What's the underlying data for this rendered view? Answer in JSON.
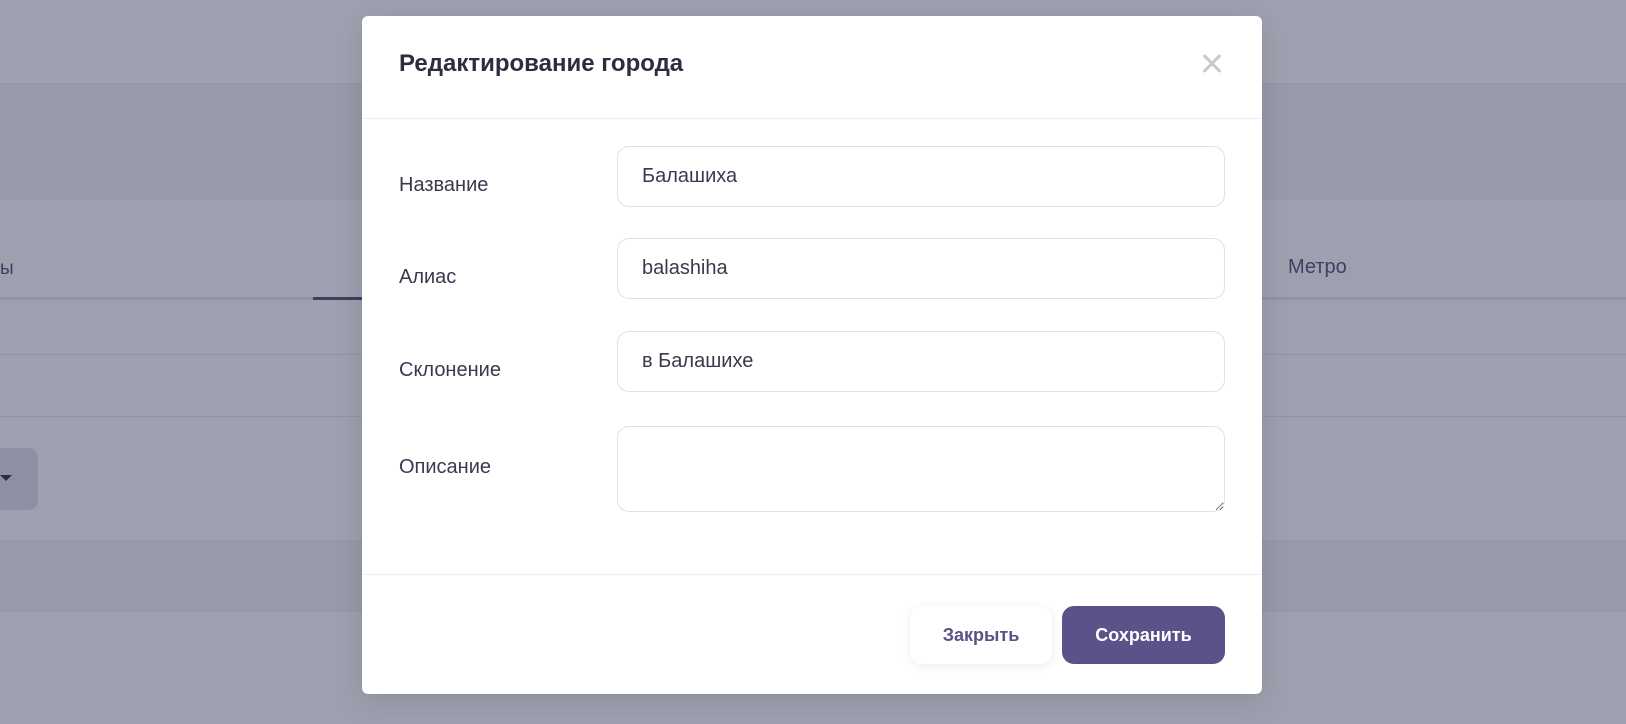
{
  "background": {
    "tab_left_fragment": "ы",
    "tab_metro": "Метро"
  },
  "modal": {
    "title": "Редактирование города",
    "fields": {
      "name": {
        "label": "Название",
        "value": "Балашиха"
      },
      "alias": {
        "label": "Алиас",
        "value": "balashiha"
      },
      "declension": {
        "label": "Склонение",
        "value": "в Балашихе"
      },
      "description": {
        "label": "Описание",
        "value": ""
      }
    },
    "buttons": {
      "close": "Закрыть",
      "save": "Сохранить"
    }
  },
  "colors": {
    "accent": "#5c5189",
    "overlay": "rgba(40, 44, 74, 0.42)"
  },
  "icons": {
    "close": "close-icon"
  }
}
